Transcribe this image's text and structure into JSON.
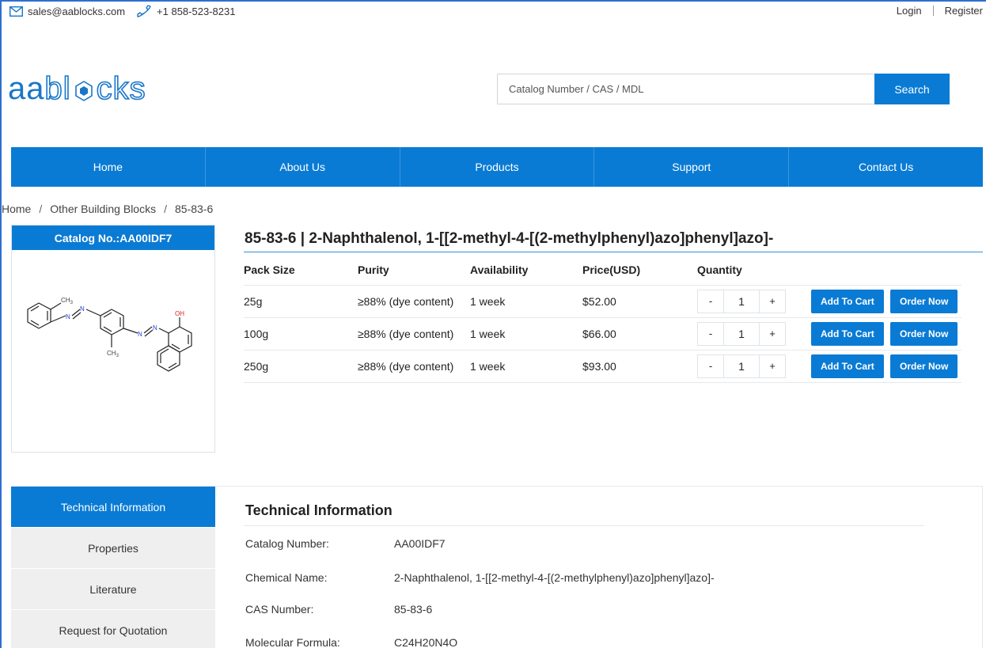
{
  "topbar": {
    "email": "sales@aablocks.com",
    "phone": "+1 858-523-8231",
    "login": "Login",
    "register": "Register"
  },
  "logo": {
    "part1": "aa",
    "part2": "bl",
    "part3": "cks"
  },
  "search": {
    "placeholder": "Catalog Number / CAS / MDL",
    "button": "Search"
  },
  "nav": [
    "Home",
    "About Us",
    "Products",
    "Support",
    "Contact Us"
  ],
  "breadcrumb": [
    "Home",
    "Other Building Blocks",
    "85-83-6"
  ],
  "breadcrumb_divider": "/",
  "product": {
    "catalog_label": "Catalog No.:AA00IDF7",
    "title": "85-83-6 | 2-Naphthalenol, 1-[[2-methyl-4-[(2-methylphenyl)azo]phenyl]azo]-",
    "structure_labels": {
      "ch3": "CH",
      "sub3": "3",
      "n": "N",
      "oh": "OH"
    }
  },
  "packs": {
    "headers": [
      "Pack Size",
      "Purity",
      "Availability",
      "Price(USD)",
      "Quantity"
    ],
    "rows": [
      {
        "size": "25g",
        "purity": "≥88% (dye content)",
        "availability": "1 week",
        "price": "$52.00",
        "qty": "1"
      },
      {
        "size": "100g",
        "purity": "≥88% (dye content)",
        "availability": "1 week",
        "price": "$66.00",
        "qty": "1"
      },
      {
        "size": "250g",
        "purity": "≥88% (dye content)",
        "availability": "1 week",
        "price": "$93.00",
        "qty": "1"
      }
    ],
    "minus": "-",
    "plus": "+",
    "add_to_cart": "Add To Cart",
    "order_now": "Order Now"
  },
  "tabs": [
    "Technical Information",
    "Properties",
    "Literature",
    "Request for Quotation"
  ],
  "technical": {
    "title": "Technical Information",
    "rows": [
      {
        "key": "Catalog Number:",
        "value": "AA00IDF7"
      },
      {
        "key": "Chemical Name:",
        "value": "2-Naphthalenol, 1-[[2-methyl-4-[(2-methylphenyl)azo]phenyl]azo]-"
      },
      {
        "key": "CAS Number:",
        "value": "85-83-6"
      },
      {
        "key": "Molecular Formula:",
        "value": "C24H20N4O"
      }
    ]
  },
  "colors": {
    "brand": "#0a7bd4",
    "oh_red": "#e0201b",
    "nitrogen_blue": "#1f3fd6"
  },
  "icons": {
    "email": "envelope-icon",
    "phone": "phone-icon"
  }
}
